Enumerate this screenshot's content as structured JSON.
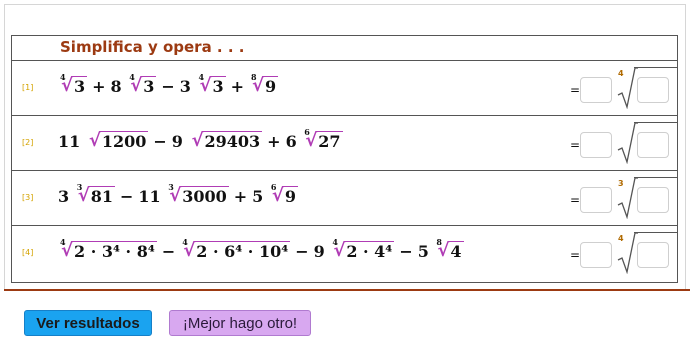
{
  "title": "Simplifica y opera . . .",
  "rows": [
    {
      "index": "[1]",
      "terms": [
        {
          "coef": "",
          "root_index": "4",
          "radicand": "3"
        },
        {
          "op": "+",
          "coef": "8",
          "root_index": "4",
          "radicand": "3"
        },
        {
          "op": "−",
          "coef": "3",
          "root_index": "4",
          "radicand": "3"
        },
        {
          "op": "+",
          "coef": "",
          "root_index": "8",
          "radicand": "9"
        }
      ],
      "equals": "=",
      "answer_root_index": "4"
    },
    {
      "index": "[2]",
      "terms": [
        {
          "coef": "11",
          "root_index": "",
          "radicand": "1200"
        },
        {
          "op": "−",
          "coef": "9",
          "root_index": "",
          "radicand": "29403"
        },
        {
          "op": "+",
          "coef": "6",
          "root_index": "6",
          "radicand": "27"
        }
      ],
      "equals": "=",
      "answer_root_index": ""
    },
    {
      "index": "[3]",
      "terms": [
        {
          "coef": "3",
          "root_index": "3",
          "radicand": "81"
        },
        {
          "op": "−",
          "coef": "11",
          "root_index": "3",
          "radicand": "3000"
        },
        {
          "op": "+",
          "coef": "5",
          "root_index": "6",
          "radicand": "9"
        }
      ],
      "equals": "=",
      "answer_root_index": "3"
    },
    {
      "index": "[4]",
      "terms": [
        {
          "coef": "",
          "root_index": "4",
          "radicand": "2 · 3⁴ · 8⁴"
        },
        {
          "op": "−",
          "coef": "",
          "root_index": "4",
          "radicand": "2 · 6⁴ · 10⁴"
        },
        {
          "op": "−",
          "coef": "9",
          "root_index": "4",
          "radicand": "2 · 4⁴"
        },
        {
          "op": "−",
          "coef": "5",
          "root_index": "8",
          "radicand": "4"
        }
      ],
      "equals": "=",
      "answer_root_index": "4"
    }
  ],
  "buttons": {
    "results": "Ver resultados",
    "other": "¡Mejor hago otro!"
  },
  "colors": {
    "title": "#9c3a12",
    "radical": "#b03cb5",
    "index": "#d4a300",
    "button_results": "#1aa3f0",
    "button_other": "#d8a8f0"
  }
}
